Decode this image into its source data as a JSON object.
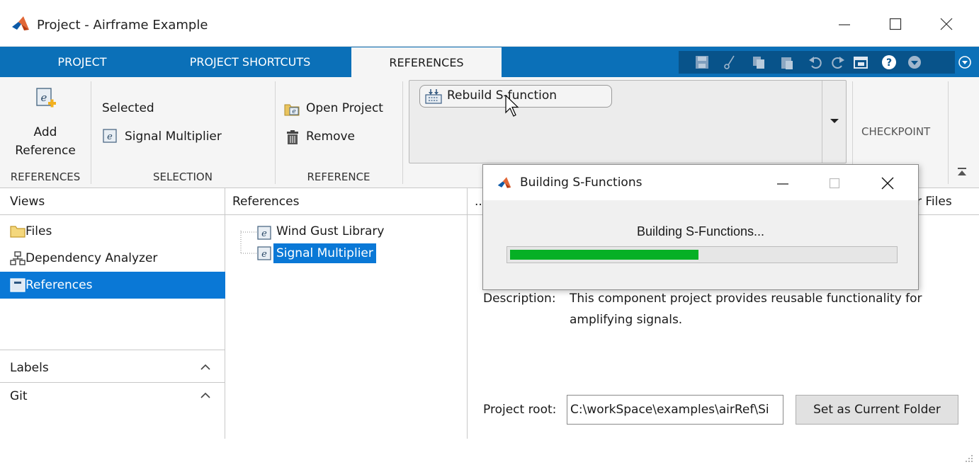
{
  "window": {
    "title": "Project - Airframe Example",
    "minimize_icon": "minimize-icon",
    "maximize_icon": "maximize-icon",
    "close_icon": "close-icon"
  },
  "tabs": [
    {
      "label": "PROJECT",
      "active": false
    },
    {
      "label": "PROJECT SHORTCUTS",
      "active": false
    },
    {
      "label": "REFERENCES",
      "active": true
    }
  ],
  "quick_access": [
    "save-icon",
    "cut-icon",
    "copy-icon",
    "paste-icon",
    "undo-icon",
    "redo-icon",
    "window-icon",
    "help-icon",
    "options-icon",
    "collapse-ribbon-icon"
  ],
  "ribbon": {
    "references_group": {
      "add_reference_line1": "Add",
      "add_reference_line2": "Reference",
      "label": "REFERENCES"
    },
    "selection_group": {
      "selected_label": "Selected",
      "selected_item": "Signal Multiplier",
      "label": "SELECTION"
    },
    "reference_group": {
      "open_project": "Open Project",
      "remove": "Remove",
      "label": "REFERENCE"
    },
    "gallery": {
      "rebuild_sfunction": "Rebuild S-function"
    },
    "checkpoint_label": "CHECKPOINT"
  },
  "views_panel": {
    "header": "Views",
    "items": [
      {
        "label": "Files",
        "icon": "folder-icon",
        "selected": false
      },
      {
        "label": "Dependency Analyzer",
        "icon": "dependency-graph-icon",
        "selected": false
      },
      {
        "label": "References",
        "icon": "references-icon",
        "selected": true
      }
    ],
    "labels_section": "Labels",
    "git_section": "Git"
  },
  "references_panel": {
    "header": "References",
    "tree": [
      {
        "label": "Wind Gust Library",
        "selected": false
      },
      {
        "label": "Signal Multiplier",
        "selected": true
      }
    ]
  },
  "details_panel": {
    "header_truncated": "..",
    "header_right": "r Files",
    "description_label": "Description:",
    "description_line1": "This component project provides reusable functionality for",
    "description_line2": "amplifying signals.",
    "project_root_label": "Project root:",
    "project_root_value": "C:\\workSpace\\examples\\airRef\\Si",
    "set_current_folder": "Set as Current Folder"
  },
  "dialog": {
    "title": "Building S-Functions",
    "message": "Building S-Functions...",
    "progress_fraction": 0.49
  }
}
